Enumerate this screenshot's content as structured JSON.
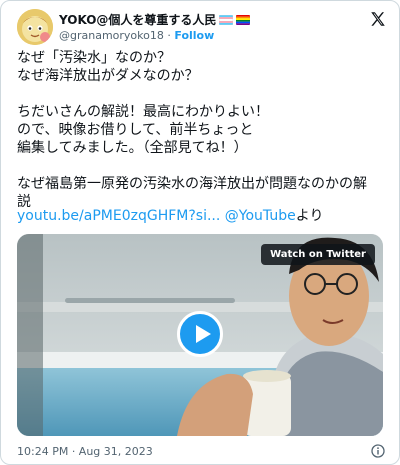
{
  "author": {
    "display_name": "YOKO@個人を尊重する人民",
    "handle": "@granamoryoko18",
    "separator": "·",
    "follow_label": "Follow",
    "flag_colors": [
      "#5bcefa",
      "#f5a9b8",
      "#ffffff",
      "#e40303",
      "#ff8c00",
      "#ffed00",
      "#008026",
      "#004dff",
      "#750787"
    ]
  },
  "tweet": {
    "text": "なぜ「汚染水」なのか？\nなぜ海洋放出がダメなのか？\n\nちだいさんの解説！最高にわかりよい！\nので、映像お借りして、前半ちょっと\n編集してみました。（全部見てね！）\n\nなぜ福島第一原発の汚染水の海洋放出が問題なのかの解\n説",
    "link_url": "youtu.be/aPME0zqGHFM?si...",
    "link_mention": "@YouTube",
    "link_suffix": "より"
  },
  "media": {
    "badge_label": "Watch on Twitter",
    "icon": "play-icon"
  },
  "footer": {
    "timestamp": "10:24 PM · Aug 31, 2023",
    "icon": "info-icon"
  },
  "colors": {
    "accent": "#1d9bf0",
    "text": "#0f1419",
    "muted": "#536471",
    "border": "#cfd9de"
  }
}
